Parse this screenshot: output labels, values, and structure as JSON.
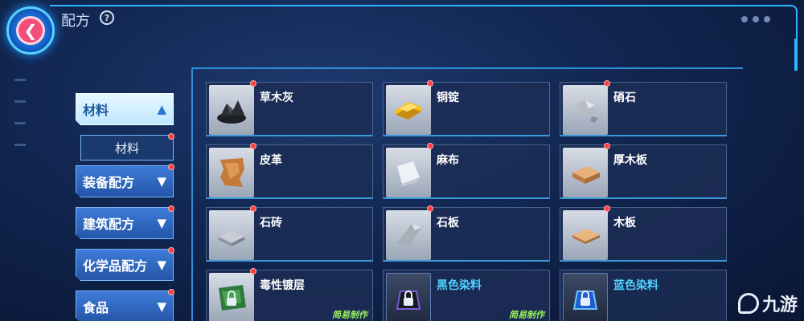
{
  "header": {
    "title": "配方",
    "help_label": "?"
  },
  "sidebar": {
    "categories": [
      {
        "label": "材料",
        "arrow": "▲"
      },
      {
        "label": "装备配方",
        "arrow": "▼"
      },
      {
        "label": "建筑配方",
        "arrow": "▼"
      },
      {
        "label": "化学品配方",
        "arrow": "▼"
      },
      {
        "label": "食品",
        "arrow": "▼"
      }
    ],
    "subcategory": "材料"
  },
  "items": [
    {
      "name": "草木灰",
      "icon": "ash-icon"
    },
    {
      "name": "铜锭",
      "icon": "copper-ingot-icon"
    },
    {
      "name": "硝石",
      "icon": "saltpeter-icon"
    },
    {
      "name": "皮革",
      "icon": "leather-icon"
    },
    {
      "name": "麻布",
      "icon": "linen-icon"
    },
    {
      "name": "厚木板",
      "icon": "thick-plank-icon"
    },
    {
      "name": "石砖",
      "icon": "stone-brick-icon"
    },
    {
      "name": "石板",
      "icon": "stone-slab-icon"
    },
    {
      "name": "木板",
      "icon": "wood-plank-icon"
    },
    {
      "name": "毒性镀层",
      "icon": "toxic-coating-icon",
      "tag": "简易制作"
    },
    {
      "name": "黑色染料",
      "icon": "black-dye-icon",
      "tag": "简易制作"
    },
    {
      "name": "蓝色染料",
      "icon": "blue-dye-icon"
    }
  ],
  "watermark": "九游",
  "colors": {
    "accent": "#2fb6ff",
    "badge": "#ff3d3d",
    "tag": "#9af25a",
    "dye_name": "#4fd0ff"
  }
}
